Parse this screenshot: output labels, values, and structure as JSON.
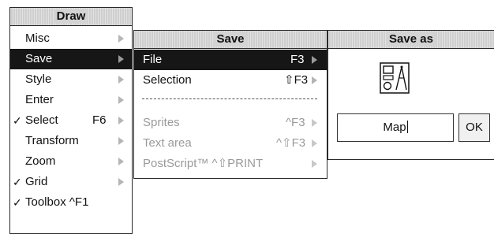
{
  "draw_menu": {
    "title": "Draw",
    "items": [
      {
        "label": "Misc",
        "ticked": false,
        "shortcut": "",
        "highlighted": false
      },
      {
        "label": "Save",
        "ticked": false,
        "shortcut": "",
        "highlighted": true
      },
      {
        "label": "Style",
        "ticked": false,
        "shortcut": "",
        "highlighted": false
      },
      {
        "label": "Enter",
        "ticked": false,
        "shortcut": "",
        "highlighted": false
      },
      {
        "label": "Select",
        "ticked": true,
        "shortcut": "F6",
        "highlighted": false
      },
      {
        "label": "Transform",
        "ticked": false,
        "shortcut": "",
        "highlighted": false
      },
      {
        "label": "Zoom",
        "ticked": false,
        "shortcut": "",
        "highlighted": false
      },
      {
        "label": "Grid",
        "ticked": true,
        "shortcut": "",
        "highlighted": false
      },
      {
        "label": "Toolbox ^F1",
        "ticked": true,
        "shortcut": "",
        "highlighted": false
      }
    ],
    "tick_glyph": "✓"
  },
  "save_menu": {
    "title": "Save",
    "items": [
      {
        "label": "File",
        "shortcut": "F3",
        "highlighted": true
      },
      {
        "label": "Selection",
        "shortcut": "⇧F3",
        "highlighted": false
      },
      {
        "label": "Sprites",
        "shortcut": "^F3",
        "highlighted": false,
        "disabled": true
      },
      {
        "label": "Text area",
        "shortcut": "^⇧F3",
        "highlighted": false,
        "disabled": true
      },
      {
        "label": "PostScript™ ^⇧PRINT",
        "shortcut": "",
        "highlighted": false,
        "disabled": true
      }
    ]
  },
  "save_as": {
    "title": "Save as",
    "file_icon": "drawfile-icon",
    "filename": "Map",
    "ok_label": "OK"
  },
  "colors": {
    "highlight": "#161616",
    "title_bar": "#cfcfcf",
    "disabled_text": "#9a9a9a"
  }
}
